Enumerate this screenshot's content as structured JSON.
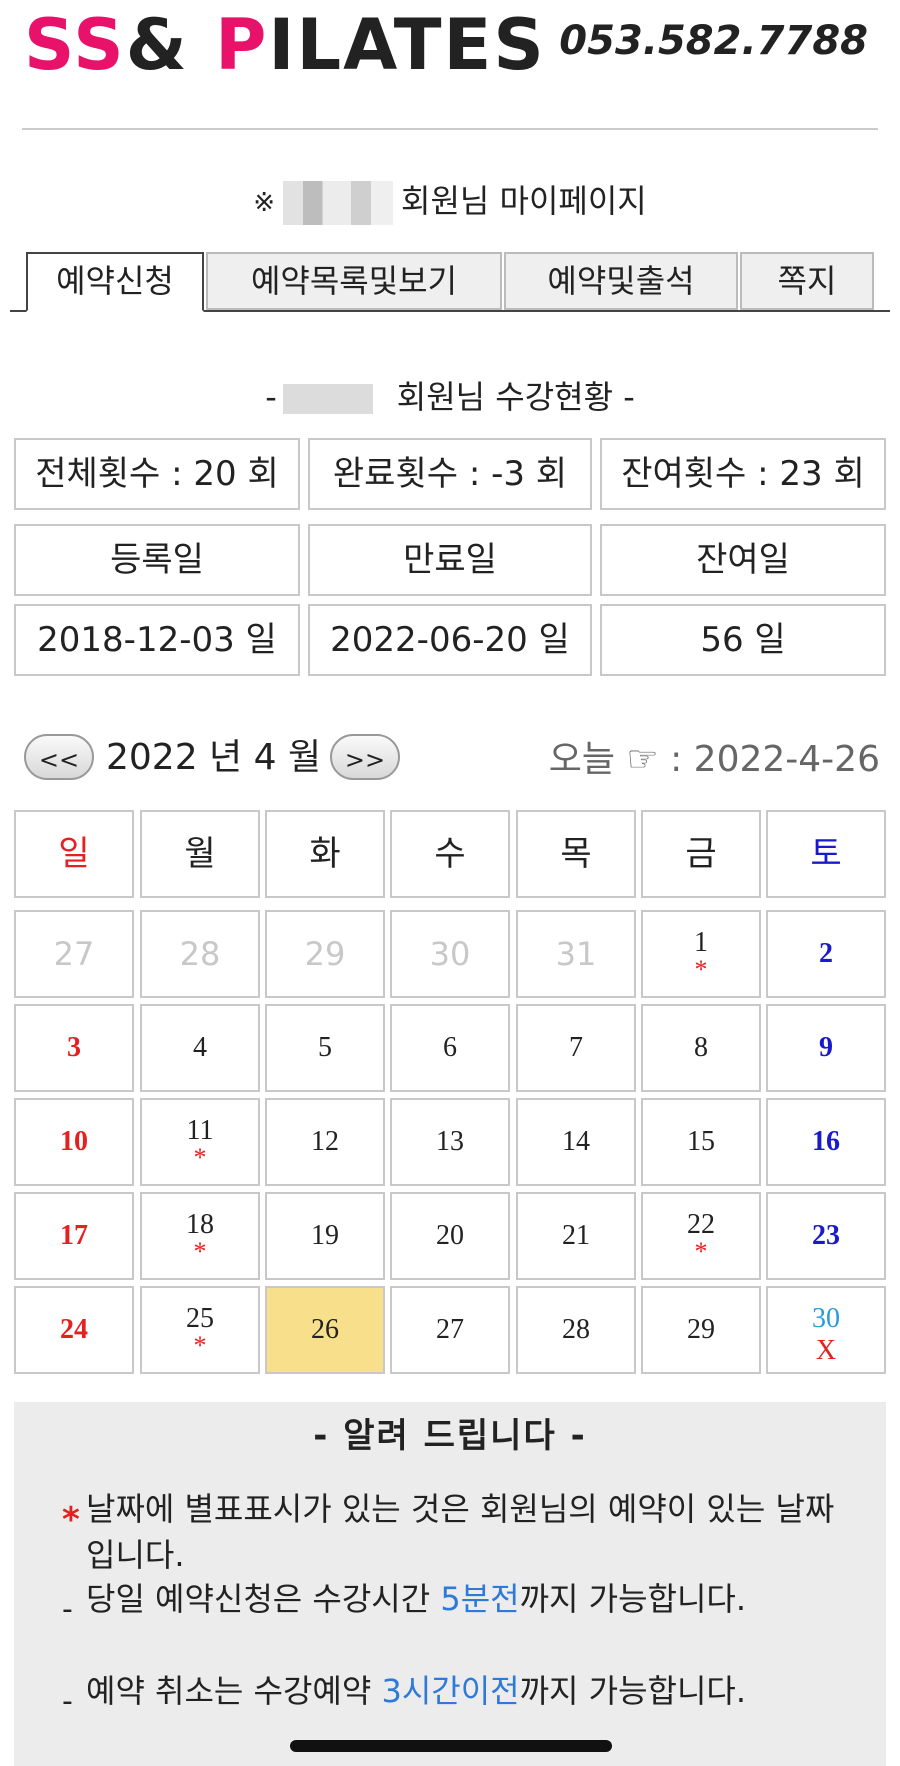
{
  "header": {
    "logo_part1": "SS",
    "logo_part2": "&",
    "logo_part3": "P",
    "logo_part4": "ILATES",
    "phone": "053.582.7788"
  },
  "mypage": {
    "mark": "※",
    "title": "회원님 마이페이지"
  },
  "tabs": [
    "예약신청",
    "예약목록및보기",
    "예약및출석",
    "쪽지"
  ],
  "status": {
    "prefix": "-",
    "title": "회원님 수강현황 -",
    "total": "전체횟수 : 20 회",
    "done": "완료횟수 : -3 회",
    "remain": "잔여횟수 : 23 회",
    "reg_label": "등록일",
    "exp_label": "만료일",
    "left_label": "잔여일",
    "reg_date": "2018-12-03 일",
    "exp_date": "2022-06-20 일",
    "left_days": "56 일"
  },
  "calendar": {
    "prev": "<<",
    "next": ">>",
    "month_title": "2022 년 4 월",
    "today_label": "오늘 ☞ : 2022-4-26",
    "weekdays": [
      "일",
      "월",
      "화",
      "수",
      "목",
      "금",
      "토"
    ],
    "weeks": [
      [
        {
          "d": "27",
          "t": "other"
        },
        {
          "d": "28",
          "t": "other"
        },
        {
          "d": "29",
          "t": "other"
        },
        {
          "d": "30",
          "t": "other"
        },
        {
          "d": "31",
          "t": "other"
        },
        {
          "d": "1",
          "star": true
        },
        {
          "d": "2",
          "t": "sat"
        }
      ],
      [
        {
          "d": "3",
          "t": "sun"
        },
        {
          "d": "4"
        },
        {
          "d": "5"
        },
        {
          "d": "6"
        },
        {
          "d": "7"
        },
        {
          "d": "8"
        },
        {
          "d": "9",
          "t": "sat"
        }
      ],
      [
        {
          "d": "10",
          "t": "sun"
        },
        {
          "d": "11",
          "star": true
        },
        {
          "d": "12"
        },
        {
          "d": "13"
        },
        {
          "d": "14"
        },
        {
          "d": "15"
        },
        {
          "d": "16",
          "t": "sat"
        }
      ],
      [
        {
          "d": "17",
          "t": "sun"
        },
        {
          "d": "18",
          "star": true
        },
        {
          "d": "19"
        },
        {
          "d": "20"
        },
        {
          "d": "21"
        },
        {
          "d": "22",
          "star": true
        },
        {
          "d": "23",
          "t": "sat"
        }
      ],
      [
        {
          "d": "24",
          "t": "sun"
        },
        {
          "d": "25",
          "star": true
        },
        {
          "d": "26",
          "today": true
        },
        {
          "d": "27"
        },
        {
          "d": "28"
        },
        {
          "d": "29"
        },
        {
          "d": "30",
          "t": "x",
          "mark": "X"
        }
      ]
    ],
    "star_symbol": "*"
  },
  "notice": {
    "title": "- 알려 드립니다 -",
    "item1": "날짜에 별표표시가 있는 것은 회원님의 예약이 있는 날짜입니다.",
    "item2_a": "당일 예약신청은 수강시간 ",
    "item2_b": "5분전",
    "item2_c": "까지 가능합니다.",
    "item3_a": "예약 취소는 수강예약 ",
    "item3_b": "3시간이전",
    "item3_c": "까지 가능합니다.",
    "bullet_star": "*",
    "bullet_dash": "-"
  },
  "colors": {
    "brand_pink": "#e8126b",
    "sunday": "#e62020",
    "saturday": "#1a1acc",
    "today_bg": "#f7df8c",
    "link_blue": "#2f7ad8"
  }
}
